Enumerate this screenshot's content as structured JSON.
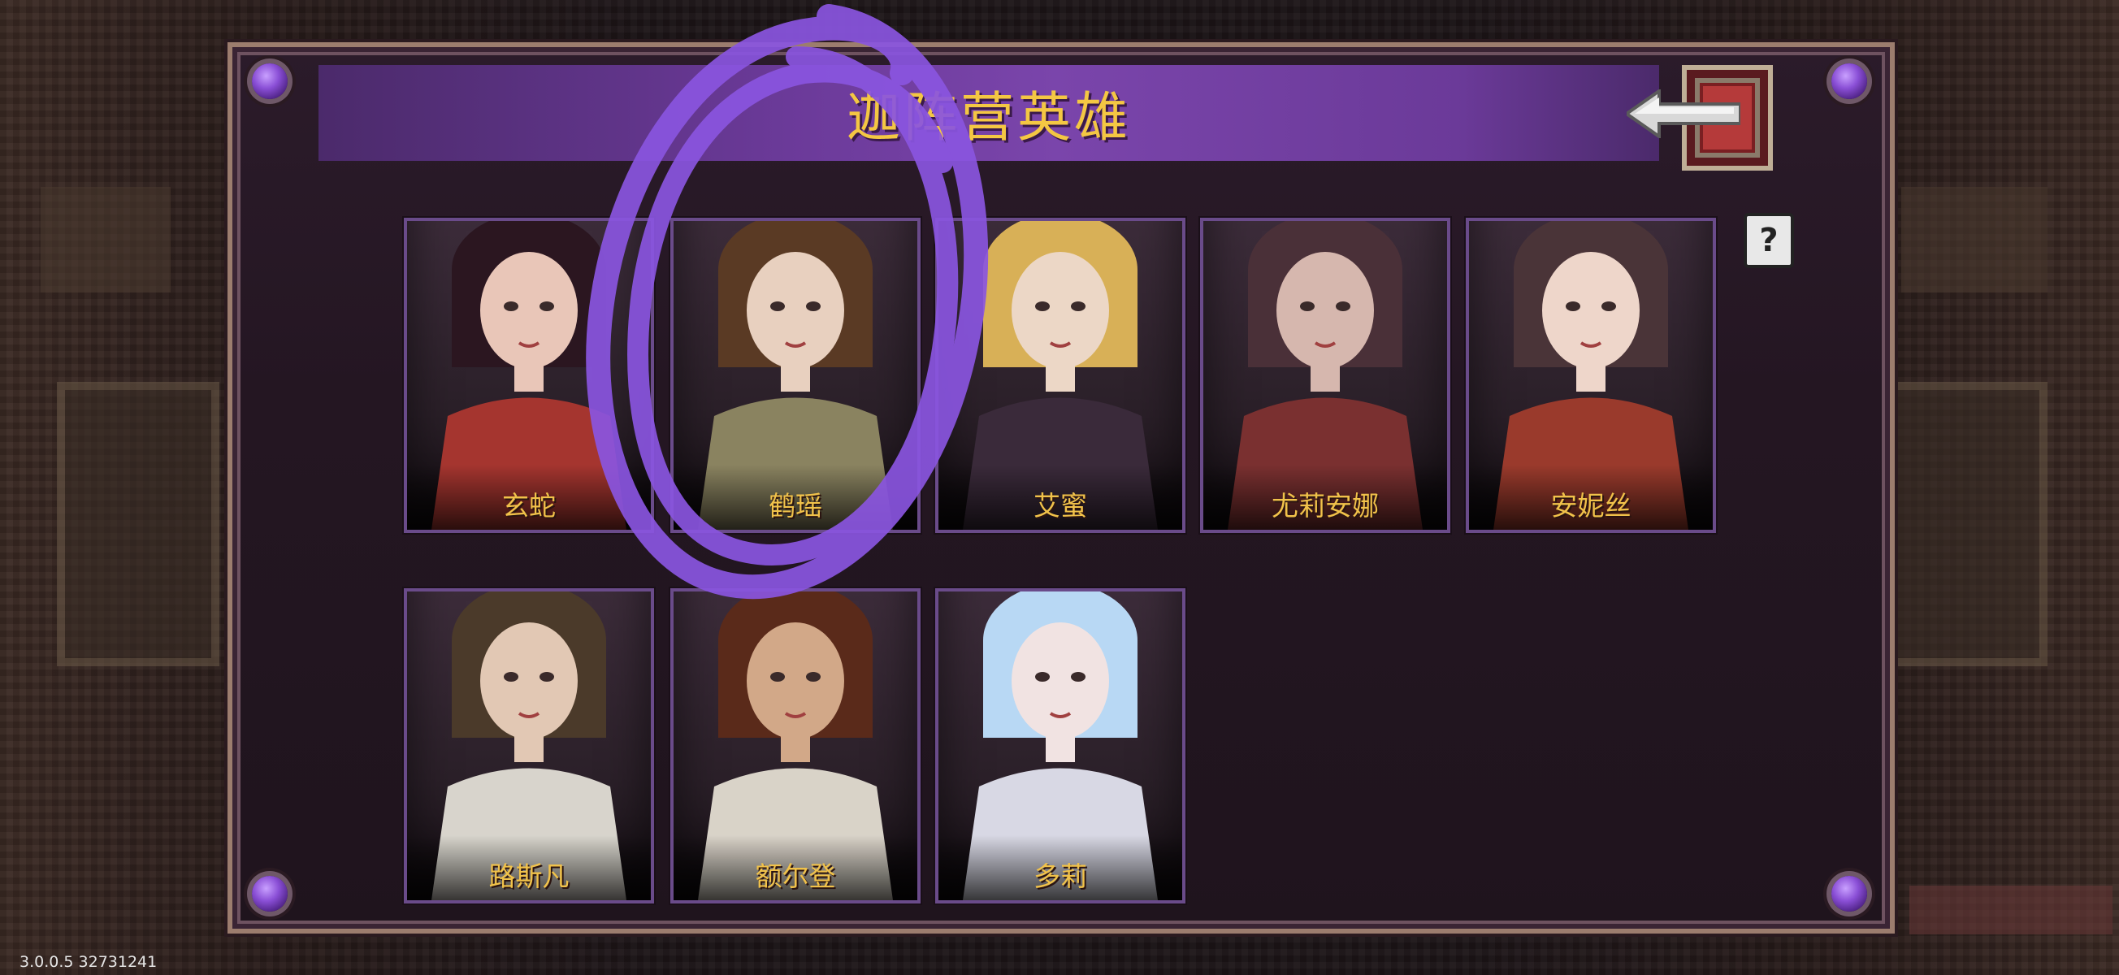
{
  "header": {
    "title": "迦阵营英雄",
    "back_icon": "back-arrow-icon",
    "help_glyph": "?"
  },
  "heroes": [
    {
      "name": "玄蛇",
      "hair": "#2b1620",
      "skin": "#e9c6b8",
      "outfit": "#a5352f"
    },
    {
      "name": "鹤瑶",
      "hair": "#5a3a24",
      "skin": "#e8d0bf",
      "outfit": "#8a8360"
    },
    {
      "name": "艾蜜",
      "hair": "#d8b057",
      "skin": "#ecd7c6",
      "outfit": "#3a2a3a"
    },
    {
      "name": "尤莉安娜",
      "hair": "#4a3038",
      "skin": "#d6b7ae",
      "outfit": "#7a3030"
    },
    {
      "name": "安妮丝",
      "hair": "#4a3438",
      "skin": "#eed6ca",
      "outfit": "#9a3a2c"
    },
    {
      "name": "路斯凡",
      "hair": "#4b3a2a",
      "skin": "#e2c8b4",
      "outfit": "#d8d4cc"
    },
    {
      "name": "额尔登",
      "hair": "#5a2a1a",
      "skin": "#d2a888",
      "outfit": "#d9d3c8"
    },
    {
      "name": "多莉",
      "hair": "#b8d8f4",
      "skin": "#f1e3e2",
      "outfit": "#d8d8e4"
    }
  ],
  "annotation": {
    "color": "#8a55e0"
  },
  "footer": {
    "version": "3.0.0.5 32731241"
  }
}
